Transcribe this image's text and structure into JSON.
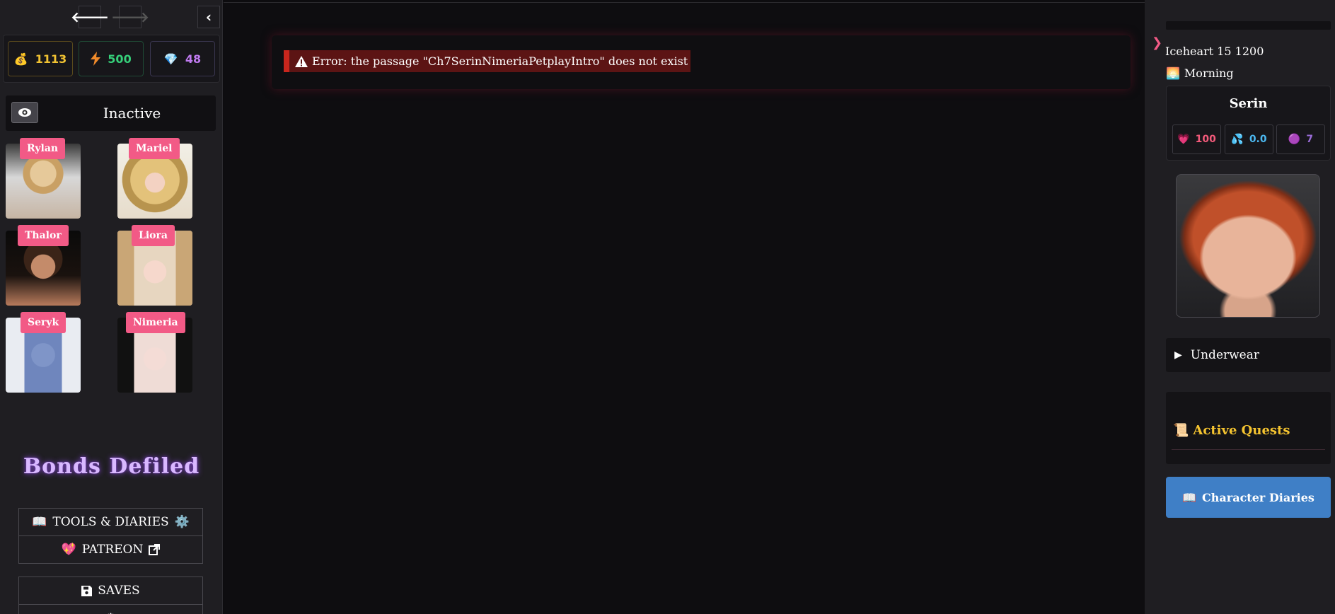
{
  "stats": {
    "gold": "1113",
    "energy": "500",
    "gems": "48"
  },
  "inactive_label": "Inactive",
  "characters": [
    {
      "name": "Rylan"
    },
    {
      "name": "Mariel"
    },
    {
      "name": "Thalor"
    },
    {
      "name": "Liora"
    },
    {
      "name": "Seryk"
    },
    {
      "name": "Nimeria"
    }
  ],
  "game_title": "Bonds Defiled",
  "menu": {
    "tools": "TOOLS & DIARIES",
    "patreon": "PATREON",
    "saves": "SAVES"
  },
  "error_message": "Error: the passage \"Ch7SerinNimeriaPetplayIntro\" does not exist",
  "right": {
    "date": "Iceheart 15 1200",
    "time_of_day": "Morning",
    "character": {
      "name": "Serin",
      "affection": "100",
      "wetness": "0.0",
      "corruption": "7"
    },
    "outfit": "Underwear",
    "quests_title": "Active Quests",
    "diaries_button": "Character Diaries"
  },
  "colors": {
    "accent_pink": "#f25a86",
    "error_red": "#c8261d",
    "button_blue": "#3f7fc6",
    "quest_gold": "#f5c430"
  }
}
